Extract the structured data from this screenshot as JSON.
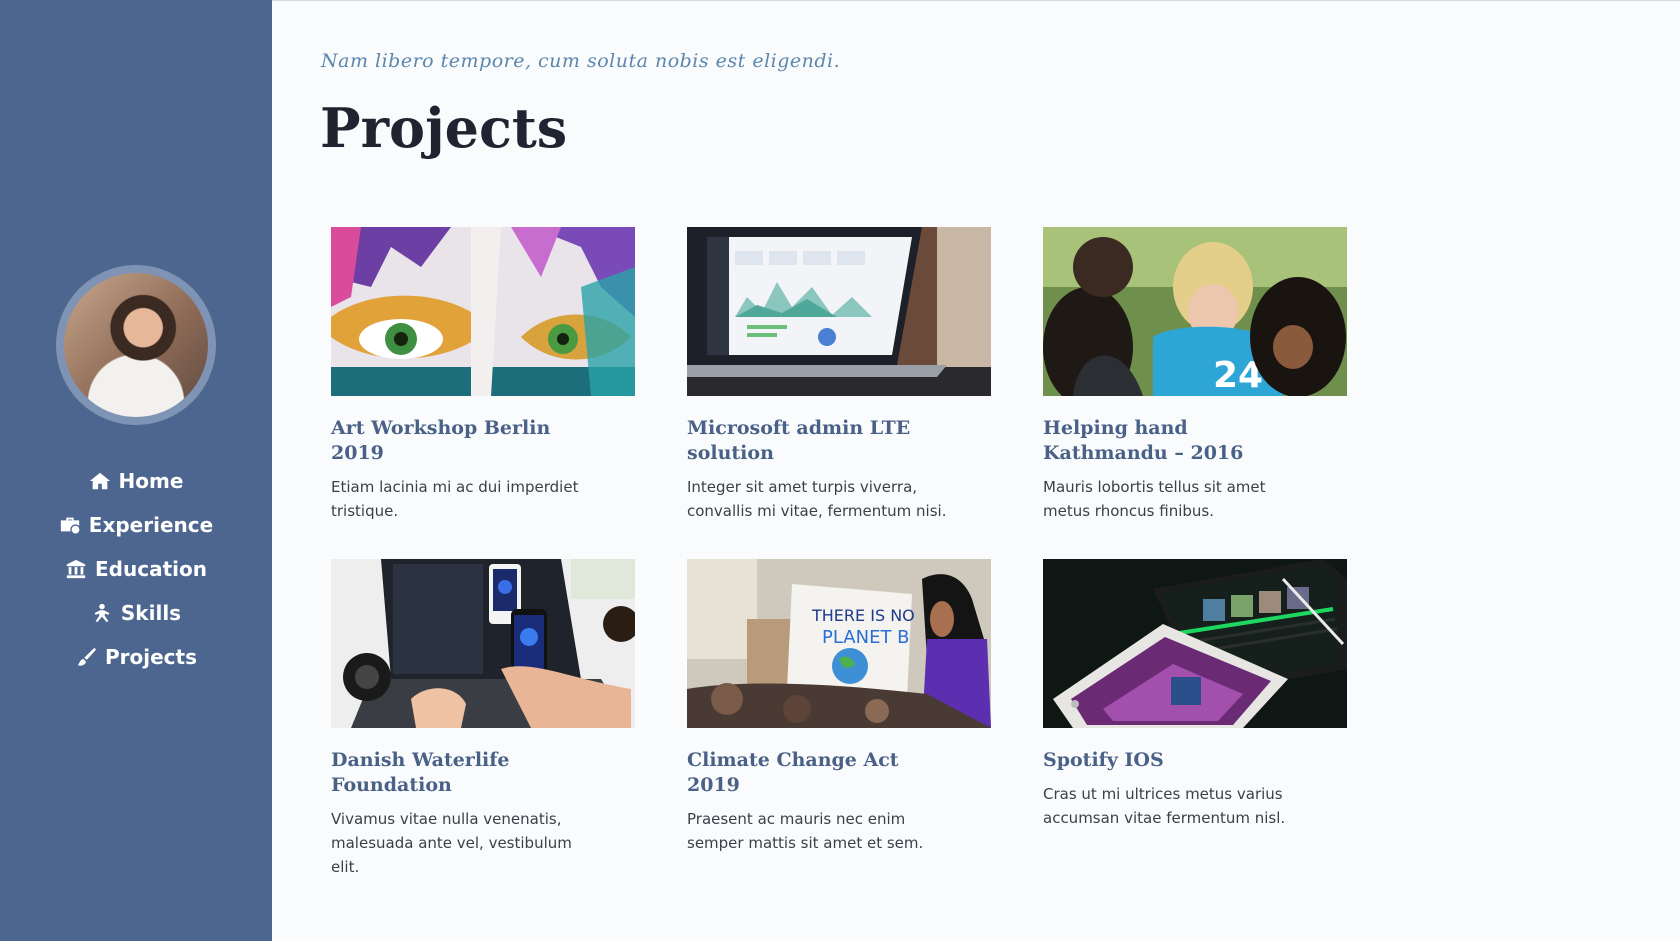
{
  "colors": {
    "sidebar_bg": "#4c6690",
    "accent": "#4a6187",
    "subtitle": "#5b86ad",
    "heading": "#1f2430"
  },
  "sidebar": {
    "nav": [
      {
        "label": "Home",
        "icon": "home-icon"
      },
      {
        "label": "Experience",
        "icon": "briefcase-icon"
      },
      {
        "label": "Education",
        "icon": "university-icon"
      },
      {
        "label": "Skills",
        "icon": "skills-icon"
      },
      {
        "label": "Projects",
        "icon": "paint-brush-icon"
      }
    ]
  },
  "main": {
    "subtitle": "Nam libero tempore, cum soluta nobis est eligendi.",
    "title": "Projects",
    "projects": [
      {
        "title": "Art Workshop Berlin 2019",
        "text": "Etiam lacinia mi ac dui imperdiet tristique."
      },
      {
        "title": "Microsoft admin LTE solution",
        "text": "Integer sit amet turpis viverra, convallis mi vitae, fermentum nisi."
      },
      {
        "title": "Helping hand Kathmandu – 2016",
        "text": "Mauris lobortis tellus sit amet metus rhoncus finibus."
      },
      {
        "title": "Danish Waterlife Foundation",
        "text": "Vivamus vitae nulla venenatis, malesuada ante vel, vestibulum elit."
      },
      {
        "title": "Climate Change Act 2019",
        "text": "Praesent ac mauris nec enim semper mattis sit amet et sem."
      },
      {
        "title": "Spotify IOS",
        "text": "Cras ut mi ultrices metus varius accumsan vitae fermentum nisl."
      }
    ]
  }
}
